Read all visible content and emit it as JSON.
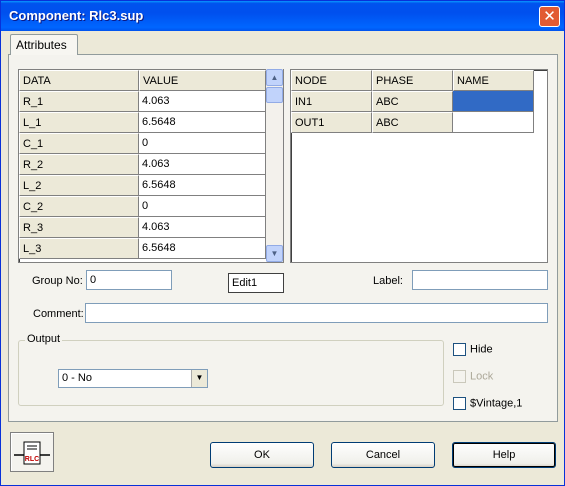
{
  "window": {
    "title": "Component: Rlc3.sup",
    "close_glyph": "✕"
  },
  "tab": {
    "label": "Attributes"
  },
  "data_grid": {
    "headers": [
      "DATA",
      "VALUE"
    ],
    "rows": [
      [
        "R_1",
        "4.063"
      ],
      [
        "L_1",
        "6.5648"
      ],
      [
        "C_1",
        "0"
      ],
      [
        "R_2",
        "4.063"
      ],
      [
        "L_2",
        "6.5648"
      ],
      [
        "C_2",
        "0"
      ],
      [
        "R_3",
        "4.063"
      ],
      [
        "L_3",
        "6.5648"
      ]
    ]
  },
  "node_grid": {
    "headers": [
      "NODE",
      "PHASE",
      "NAME"
    ],
    "rows": [
      [
        "IN1",
        "ABC",
        ""
      ],
      [
        "OUT1",
        "ABC",
        ""
      ]
    ],
    "selected_cell_color": "#316ac5"
  },
  "fields": {
    "group_no_label": "Group No:",
    "group_no_value": "0",
    "edit1_value": "Edit1",
    "label_label": "Label:",
    "label_value": "",
    "comment_label": "Comment:",
    "comment_value": ""
  },
  "output": {
    "title": "Output",
    "selected": "0 - No"
  },
  "checkboxes": {
    "hide": "Hide",
    "lock": "Lock",
    "vintage": "$Vintage,1"
  },
  "buttons": {
    "ok": "OK",
    "cancel": "Cancel",
    "help": "Help"
  },
  "component_icon": {
    "name": "rlc-component-icon",
    "text": "RLC"
  }
}
